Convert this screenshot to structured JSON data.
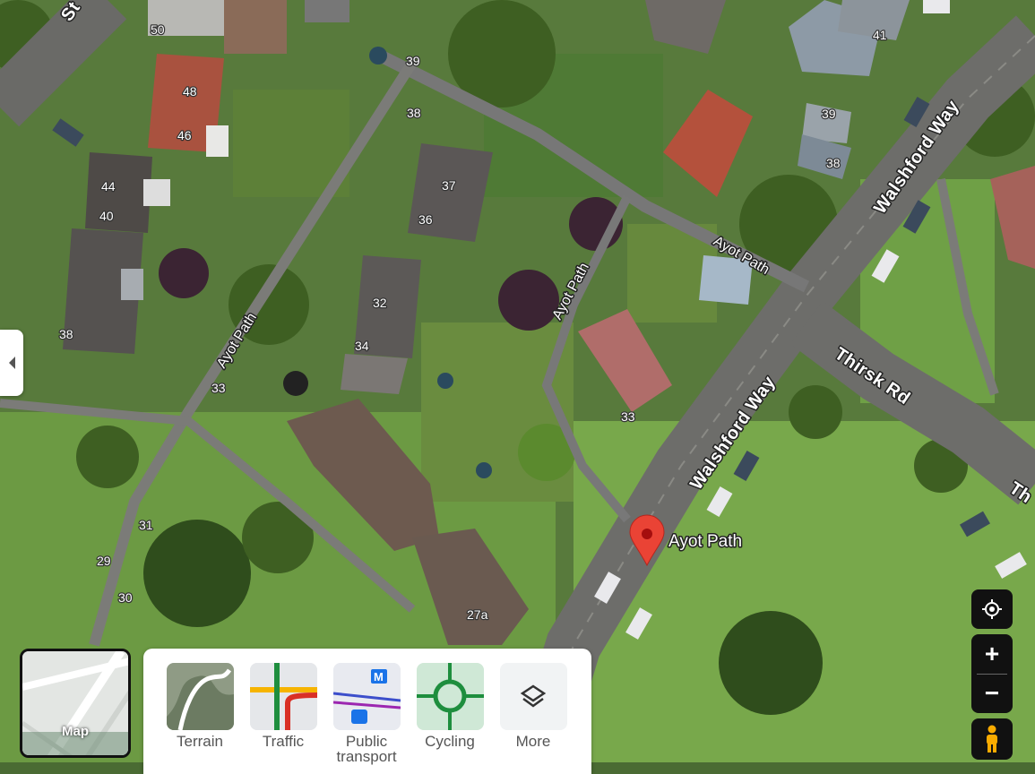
{
  "map": {
    "view": "satellite",
    "roads": {
      "walshford_way_upper": "Walshford Way",
      "walshford_way_lower": "Walshford Way",
      "thirsk_rd": "Thirsk Rd",
      "thirsk_edge": "Th",
      "st_edge": "St",
      "ayot_path_left": "Ayot Path",
      "ayot_path_middle": "Ayot Path",
      "ayot_path_upper": "Ayot Path"
    },
    "house_numbers": {
      "n50": "50",
      "n48": "48",
      "n46": "46",
      "n44": "44",
      "n40": "40",
      "n38a": "38",
      "n39a": "39",
      "n38b": "38",
      "n37": "37",
      "n36": "36",
      "n32": "32",
      "n34": "34",
      "n33a": "33",
      "n33b": "33",
      "n31": "31",
      "n29": "29",
      "n30": "30",
      "n27a": "27a",
      "n41": "41",
      "n39b": "39",
      "n38c": "38"
    },
    "pin": {
      "label": "Ayot Path",
      "color": "#ea4335"
    }
  },
  "controls": {
    "sidebar_toggle_icon": "chevron-left-icon",
    "map_type_label": "Map",
    "layers": [
      {
        "label": "Terrain",
        "icon": "terrain-icon"
      },
      {
        "label": "Traffic",
        "icon": "traffic-icon"
      },
      {
        "label": "Public transport",
        "icon": "public-transport-icon"
      },
      {
        "label": "Cycling",
        "icon": "cycling-icon"
      },
      {
        "label": "More",
        "icon": "layers-icon"
      }
    ],
    "zoom_in": "+",
    "zoom_out": "−"
  }
}
